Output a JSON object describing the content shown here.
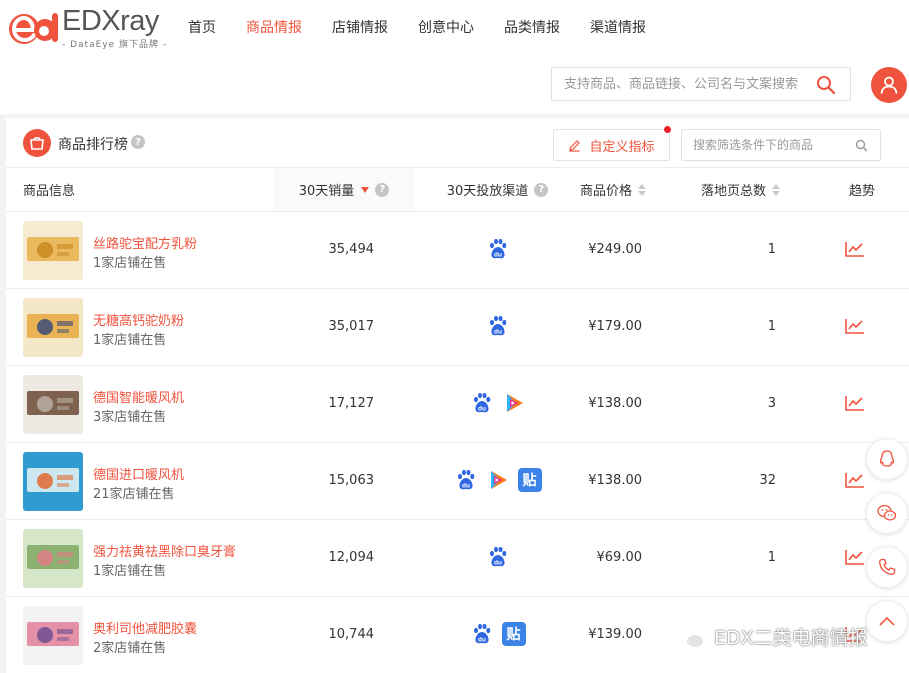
{
  "brand": {
    "logo_text": "EDXray",
    "logo_sub": "- DataEye 旗下品牌 -",
    "accent": "#f0533d"
  },
  "nav": {
    "items": [
      {
        "label": "首页",
        "active": false
      },
      {
        "label": "商品情报",
        "active": true
      },
      {
        "label": "店铺情报",
        "active": false
      },
      {
        "label": "创意中心",
        "active": false
      },
      {
        "label": "品类情报",
        "active": false
      },
      {
        "label": "渠道情报",
        "active": false
      }
    ]
  },
  "header_search": {
    "placeholder": "支持商品、商品链接、公司名与文案搜索"
  },
  "panel": {
    "title": "商品排行榜",
    "custom_metric_label": "自定义指标",
    "filter_placeholder": "搜索筛选条件下的商品"
  },
  "table": {
    "columns": {
      "product": "商品信息",
      "sales_30d": "30天销量",
      "channels_30d": "30天投放渠道",
      "price": "商品价格",
      "landing_pages": "落地页总数",
      "trend": "趋势"
    },
    "rows": [
      {
        "name": "丝路驼宝配方乳粉",
        "stores": "1家店铺在售",
        "sales": "35,494",
        "channels": [
          "baidu"
        ],
        "price": "¥249.00",
        "pages": "1"
      },
      {
        "name": "无糖高钙驼奶粉",
        "stores": "1家店铺在售",
        "sales": "35,017",
        "channels": [
          "baidu"
        ],
        "price": "¥179.00",
        "pages": "1"
      },
      {
        "name": "德国智能暖风机",
        "stores": "3家店铺在售",
        "sales": "17,127",
        "channels": [
          "baidu",
          "tencent-video"
        ],
        "price": "¥138.00",
        "pages": "3"
      },
      {
        "name": "德国进口暖风机",
        "stores": "21家店铺在售",
        "sales": "15,063",
        "channels": [
          "baidu",
          "tencent-video",
          "tieba"
        ],
        "price": "¥138.00",
        "pages": "32"
      },
      {
        "name": "强力祛黄祛黑除口臭牙膏",
        "stores": "1家店铺在售",
        "sales": "12,094",
        "channels": [
          "baidu"
        ],
        "price": "¥69.00",
        "pages": "1"
      },
      {
        "name": "奥利司他减肥胶囊",
        "stores": "2家店铺在售",
        "sales": "10,744",
        "channels": [
          "baidu",
          "tieba"
        ],
        "price": "¥139.00",
        "pages": ""
      }
    ]
  },
  "tieba_glyph": "贴",
  "watermark": "EDX二类电商情报"
}
